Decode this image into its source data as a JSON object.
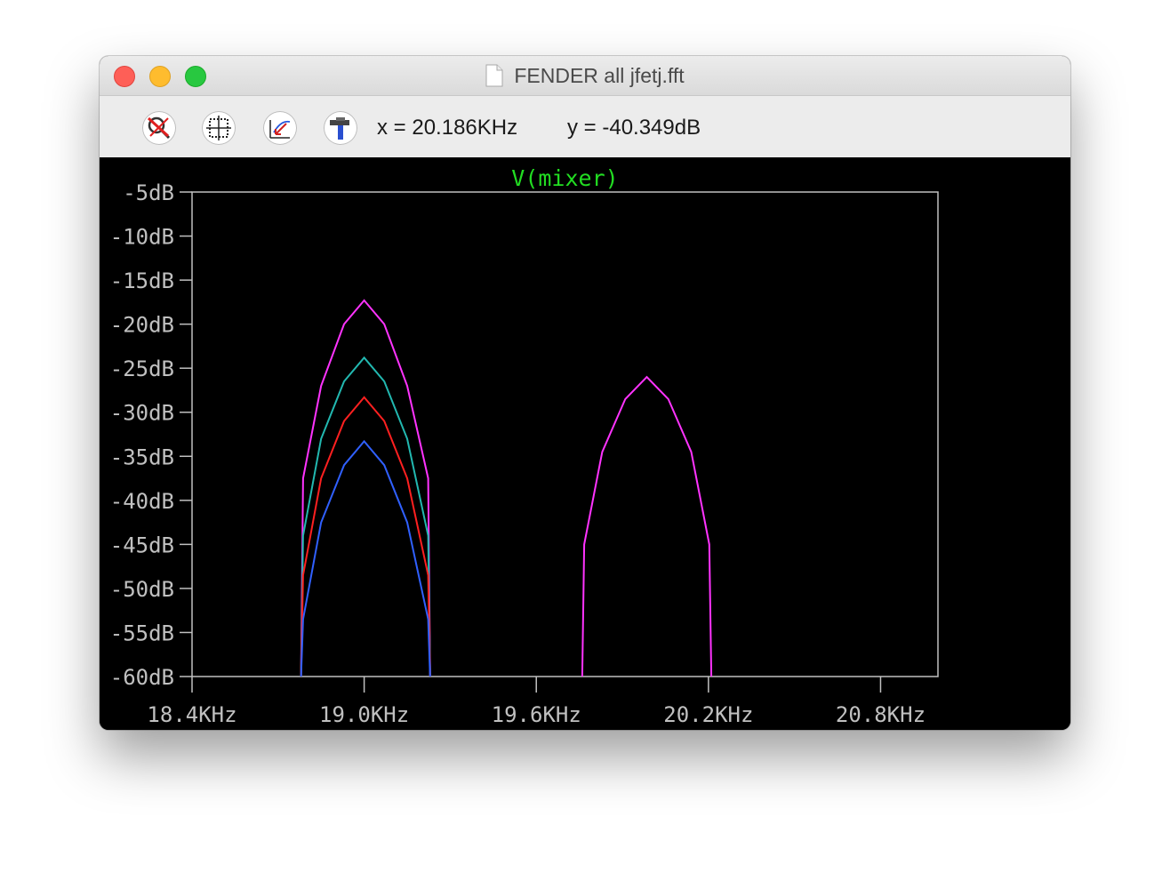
{
  "window": {
    "title": "FENDER all jfetj.fft"
  },
  "toolbar": {
    "buttons": [
      {
        "icon": "zoom-cancel-icon"
      },
      {
        "icon": "autorange-icon"
      },
      {
        "icon": "pan-icon"
      },
      {
        "icon": "hammer-icon"
      }
    ],
    "cursor_x": "x = 20.186KHz",
    "cursor_y": "y = -40.349dB"
  },
  "chart_data": {
    "type": "line",
    "title": "V(mixer)",
    "title_color": "#22dd22",
    "xlim": [
      18.4,
      21.0
    ],
    "ylim": [
      -60,
      -5
    ],
    "x_ticks": [
      18.4,
      19.0,
      19.6,
      20.2,
      20.8
    ],
    "x_tick_labels": [
      "18.4KHz",
      "19.0KHz",
      "19.6KHz",
      "20.2KHz",
      "20.8KHz"
    ],
    "y_ticks": [
      -5,
      -10,
      -15,
      -20,
      -25,
      -30,
      -35,
      -40,
      -45,
      -50,
      -55,
      -60
    ],
    "y_tick_labels": [
      "-5dB",
      "-10dB",
      "-15dB",
      "-20dB",
      "-25dB",
      "-30dB",
      "-35dB",
      "-40dB",
      "-45dB",
      "-50dB",
      "-55dB",
      "-60dB"
    ],
    "grid": false,
    "background": "#000000",
    "axis_color": "#c0c0c0",
    "series": [
      {
        "color": "#ff33ff",
        "points": [
          [
            18.78,
            -60
          ],
          [
            18.787,
            -37.5
          ],
          [
            18.85,
            -27
          ],
          [
            18.93,
            -20
          ],
          [
            19.0,
            -17.3
          ],
          [
            19.07,
            -20
          ],
          [
            19.15,
            -27
          ],
          [
            19.223,
            -37.5
          ],
          [
            19.23,
            -60
          ]
        ]
      },
      {
        "color": "#22b8b0",
        "points": [
          [
            18.78,
            -60
          ],
          [
            18.787,
            -44
          ],
          [
            18.85,
            -33
          ],
          [
            18.93,
            -26.5
          ],
          [
            19.0,
            -23.8
          ],
          [
            19.07,
            -26.5
          ],
          [
            19.15,
            -33
          ],
          [
            19.223,
            -44
          ],
          [
            19.23,
            -60
          ]
        ]
      },
      {
        "color": "#ff2020",
        "points": [
          [
            18.78,
            -60
          ],
          [
            18.787,
            -48.5
          ],
          [
            18.85,
            -37.5
          ],
          [
            18.93,
            -31
          ],
          [
            19.0,
            -28.3
          ],
          [
            19.07,
            -31
          ],
          [
            19.15,
            -37.5
          ],
          [
            19.223,
            -48.5
          ],
          [
            19.23,
            -60
          ]
        ]
      },
      {
        "color": "#3060ff",
        "points": [
          [
            18.78,
            -60
          ],
          [
            18.787,
            -53.5
          ],
          [
            18.85,
            -42.5
          ],
          [
            18.93,
            -36
          ],
          [
            19.0,
            -33.3
          ],
          [
            19.07,
            -36
          ],
          [
            19.15,
            -42.5
          ],
          [
            19.223,
            -53.5
          ],
          [
            19.23,
            -60
          ]
        ]
      },
      {
        "color": "#ff33ff",
        "points": [
          [
            19.76,
            -60
          ],
          [
            19.767,
            -45
          ],
          [
            19.83,
            -34.5
          ],
          [
            19.91,
            -28.5
          ],
          [
            19.985,
            -26
          ],
          [
            20.06,
            -28.5
          ],
          [
            20.14,
            -34.5
          ],
          [
            20.203,
            -45
          ],
          [
            20.21,
            -60
          ]
        ]
      }
    ]
  }
}
